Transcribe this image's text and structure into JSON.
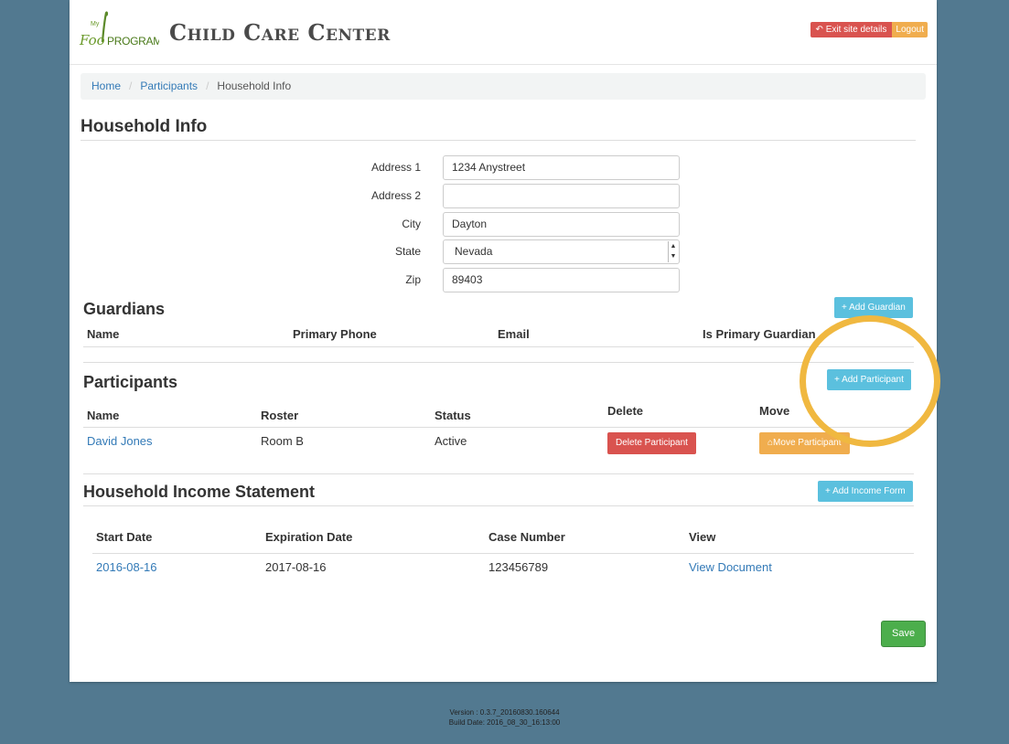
{
  "header": {
    "logo_text": "MyFoodPROGRAM",
    "site_title": "Child Care Center",
    "exit_label": "Exit site details",
    "logout_label": "Logout"
  },
  "breadcrumb": {
    "home": "Home",
    "participants": "Participants",
    "current": "Household Info"
  },
  "household": {
    "title": "Household Info",
    "fields": [
      {
        "label": "Address 1",
        "value": "1234 Anystreet"
      },
      {
        "label": "Address 2",
        "value": ""
      },
      {
        "label": "City",
        "value": "Dayton"
      },
      {
        "label": "State",
        "value": "Nevada"
      },
      {
        "label": "Zip",
        "value": "89403"
      }
    ]
  },
  "guardians": {
    "title": "Guardians",
    "add_label": "+ Add Guardian",
    "columns": [
      "Name",
      "Primary Phone",
      "Email",
      "Is Primary Guardian"
    ]
  },
  "participants": {
    "title": "Participants",
    "add_label": "+ Add Participant",
    "columns": [
      "Name",
      "Roster",
      "Status",
      "Delete",
      "Move"
    ],
    "rows": [
      {
        "name": "David Jones",
        "roster": "Room B",
        "status": "Active",
        "delete_label": "Delete Participant",
        "move_label": "Move Participant"
      }
    ]
  },
  "income": {
    "title": "Household Income Statement",
    "add_label": "+ Add Income Form",
    "columns": [
      "Start Date",
      "Expiration Date",
      "Case Number",
      "View"
    ],
    "rows": [
      {
        "start": "2016-08-16",
        "expiration": "2017-08-16",
        "case_number": "123456789",
        "view": "View Document"
      }
    ]
  },
  "save_label": "Save",
  "footer": {
    "version": "Version : 0.3.7_20160830.160644",
    "build_date": "Build Date: 2016_08_30_16:13:00"
  },
  "colors": {
    "background": "#527990",
    "highlight_circle": "#f0b840",
    "link": "#337ab7",
    "info": "#5bc0de",
    "danger": "#d9534f",
    "warning": "#f0ad4e",
    "success": "#4cae4c"
  }
}
